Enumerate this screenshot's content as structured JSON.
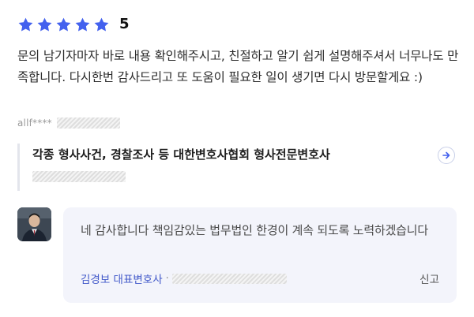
{
  "review": {
    "star_count": 5,
    "star_color": "#4361ee",
    "score": "5",
    "text": "문의 남기자마자 바로 내용 확인해주시고, 친절하고 알기 쉽게 설명해주셔서 너무나도 만족합니다. 다시한번 감사드리고 또 도움이 필요한 일이 생기면 다시 방문할게요 :)",
    "author_id": "allf****"
  },
  "product": {
    "title": "각종 형사사건, 경찰조사 등 대한변호사협회 형사전문변호사"
  },
  "reply": {
    "text": "네 감사합니다 책임감있는 법무법인 한경이 계속 되도록 노력하겠습니다",
    "lawyer_name": "김경보 대표변호사",
    "separator": "·",
    "report_label": "신고",
    "lawyer_color": "#4158c9",
    "background": "#f3f4fb"
  }
}
